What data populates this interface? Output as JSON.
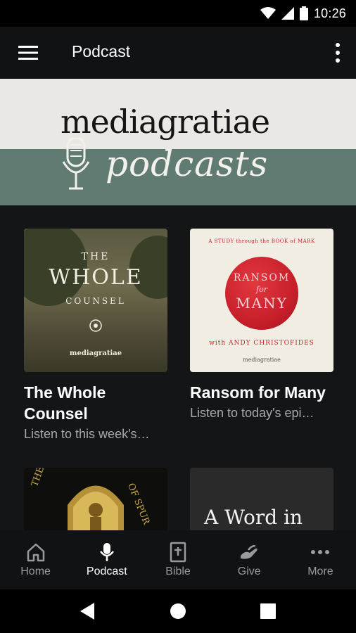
{
  "status": {
    "time": "10:26"
  },
  "app_bar": {
    "title": "Podcast",
    "menu_icon": "hamburger-menu-icon",
    "overflow_icon": "more-vertical-icon"
  },
  "banner": {
    "wordmark": "mediagratiae",
    "subtitle": "podcasts",
    "icon": "microphone-icon"
  },
  "cards": [
    {
      "title": "The Whole Counsel",
      "description": "Listen to this week's…",
      "art": {
        "line1": "THE",
        "line2": "WHOLE",
        "line3": "COUNSEL",
        "brand": "mediagratiae"
      }
    },
    {
      "title": "Ransom for Many",
      "description": "Listen to today's epi…",
      "art": {
        "top": "A STUDY through the BOOK of MARK",
        "seal_top": "RANSOM",
        "seal_mid": "for",
        "seal_bottom": "MANY",
        "author": "with ANDY CHRISTOFIDES",
        "brand": "mediagratiae"
      }
    },
    {
      "art": {
        "arc_left": "THE HEART",
        "arc_right": "OF SPUR"
      }
    },
    {
      "art": {
        "text": "A Word in"
      }
    }
  ],
  "bottom_nav": [
    {
      "label": "Home",
      "icon": "home-icon",
      "active": false
    },
    {
      "label": "Podcast",
      "icon": "microphone-icon",
      "active": true
    },
    {
      "label": "Bible",
      "icon": "bible-icon",
      "active": false
    },
    {
      "label": "Give",
      "icon": "give-hand-icon",
      "active": false
    },
    {
      "label": "More",
      "icon": "more-horizontal-icon",
      "active": false
    }
  ],
  "colors": {
    "app_bar": "#111214",
    "content_bg": "#141517",
    "banner_green": "#5f7b72",
    "seal_red": "#c8202b",
    "inactive": "#9a9a9a"
  }
}
